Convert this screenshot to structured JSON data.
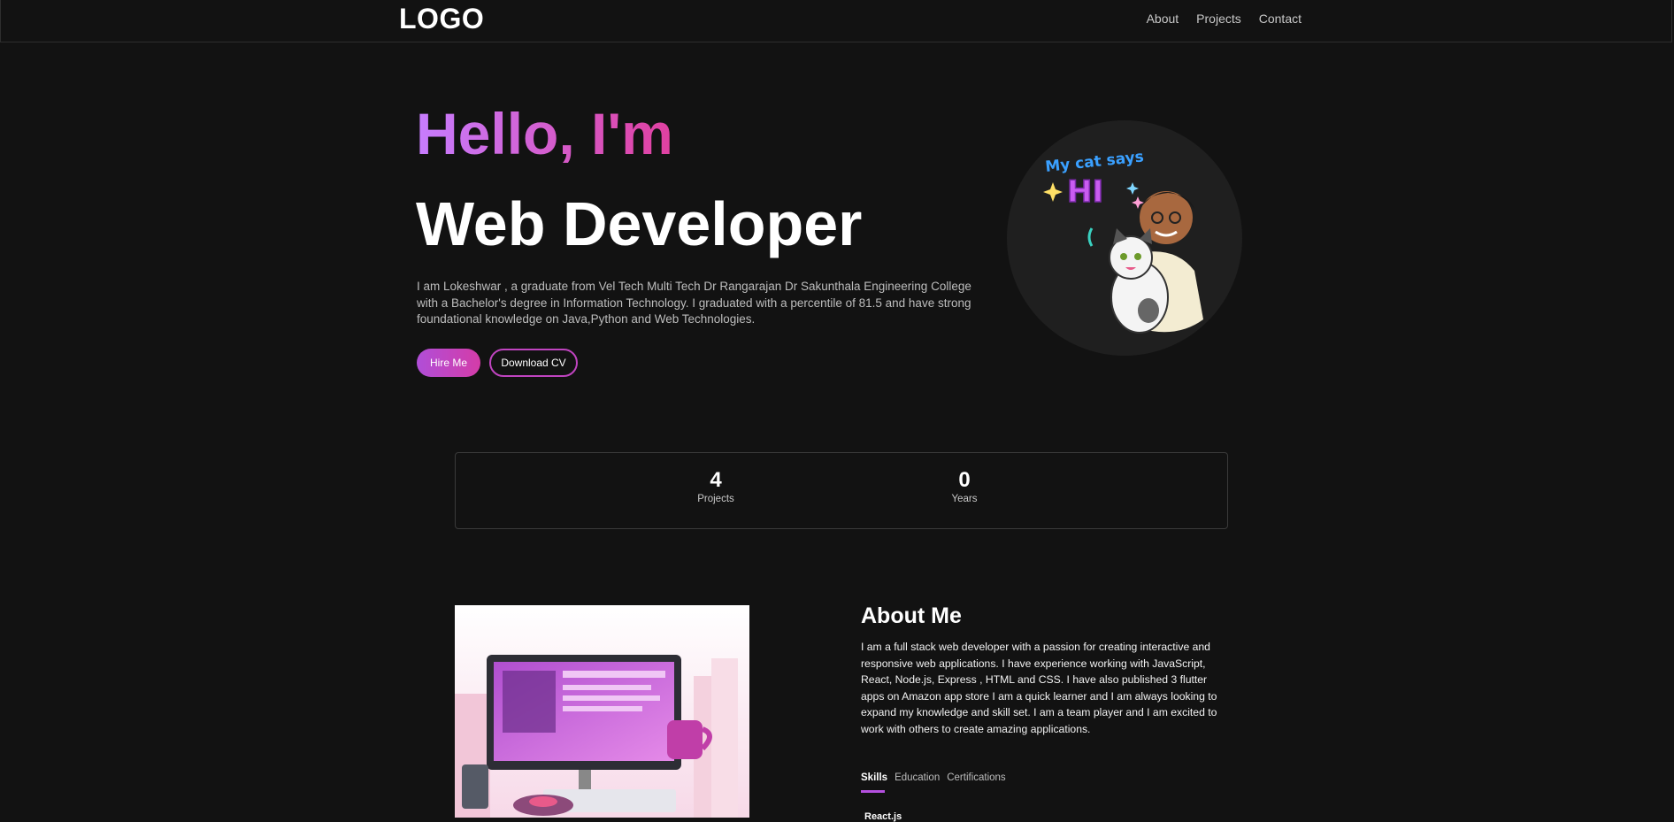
{
  "nav": {
    "logo": "LOGO",
    "links": [
      "About",
      "Projects",
      "Contact"
    ]
  },
  "hero": {
    "greeting": "Hello, I'm",
    "title": "Web Developer",
    "description": "I am Lokeshwar , a graduate from Vel Tech Multi Tech Dr Rangarajan Dr Sakunthala Engineering College with a Bachelor's degree in Information Technology. I graduated with a percentile of 81.5 and have strong foundational knowledge on Java,Python and Web Technologies.",
    "hire_label": "Hire Me",
    "cv_label": "Download CV",
    "avatar_caption_top": "My cat says",
    "avatar_caption_big": "HI"
  },
  "stats": [
    {
      "value": "4",
      "label": "Projects"
    },
    {
      "value": "0",
      "label": "Years"
    }
  ],
  "about": {
    "title": "About Me",
    "text": "I am a full stack web developer with a passion for creating interactive and responsive web applications. I have experience working with JavaScript, React, Node.js, Express , HTML and CSS. I have also published 3 flutter apps on Amazon app store I am a quick learner and I am always looking to expand my knowledge and skill set. I am a team player and I am excited to work with others to create amazing applications.",
    "tabs": [
      "Skills",
      "Education",
      "Certifications"
    ],
    "skills": [
      "React.js"
    ]
  },
  "colors": {
    "background": "#121212",
    "accent_purple": "#c77dff",
    "accent_pink": "#e040a0"
  }
}
